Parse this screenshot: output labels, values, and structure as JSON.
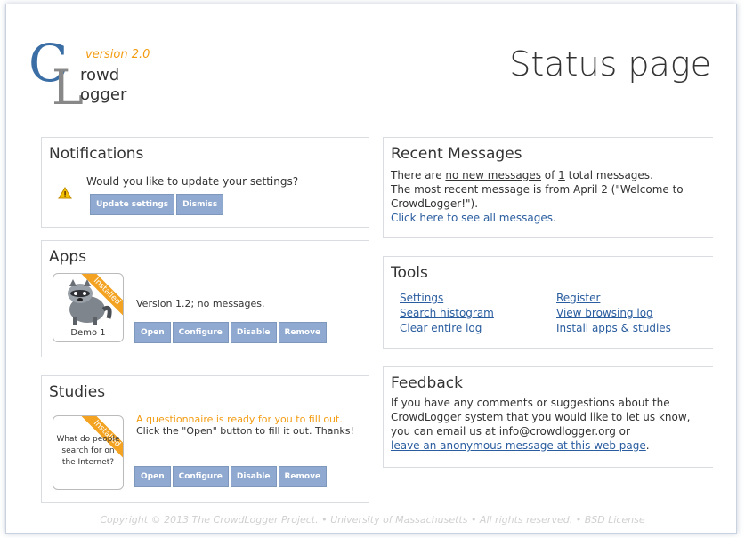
{
  "logo": {
    "version": "version 2.0",
    "line1": "rowd",
    "line2": "ogger"
  },
  "page_title": "Status page",
  "notifications": {
    "title": "Notifications",
    "message": "Would you like to update your settings?",
    "update_button": "Update settings",
    "dismiss_button": "Dismiss"
  },
  "apps": {
    "title": "Apps",
    "items": [
      {
        "name": "Demo 1",
        "ribbon": "Installed",
        "status": "Version 1.2; no messages.",
        "buttons": [
          "Open",
          "Configure",
          "Disable",
          "Remove"
        ]
      }
    ]
  },
  "studies": {
    "title": "Studies",
    "items": [
      {
        "name": "What do people search for on the Internet?",
        "ribbon": "Installed",
        "alert": "A questionnaire is ready for you to fill out.",
        "status": "Click the \"Open\" button to fill it out. Thanks!",
        "buttons": [
          "Open",
          "Configure",
          "Disable",
          "Remove"
        ]
      }
    ]
  },
  "recent_messages": {
    "title": "Recent Messages",
    "text_prefix": "There are ",
    "new_link": "no new messages",
    "text_mid": " of ",
    "total_link": "1",
    "text_suffix": " total messages.",
    "line2": "The most recent message is from April 2 (\"Welcome to CrowdLogger!\").",
    "click_link": "Click here",
    "click_suffix": " to see all messages."
  },
  "tools": {
    "title": "Tools",
    "links": [
      "Settings",
      "Register",
      "Search histogram",
      "View browsing log",
      "Clear entire log",
      "Install apps & studies"
    ]
  },
  "feedback": {
    "title": "Feedback",
    "text": "If you have any comments or suggestions about the CrowdLogger system that you would like to let us know, you can email us at info@crowdlogger.org or",
    "link": "leave an anonymous message at this web page",
    "suffix": "."
  },
  "footer": {
    "text": "Copyright © 2013 The CrowdLogger Project. • University of Massachusetts • All rights reserved. • BSD License"
  },
  "colors": {
    "button": "#8fa9d0",
    "link": "#2a5d9f",
    "alert": "#f39c12",
    "ribbon": "#f3a321"
  }
}
